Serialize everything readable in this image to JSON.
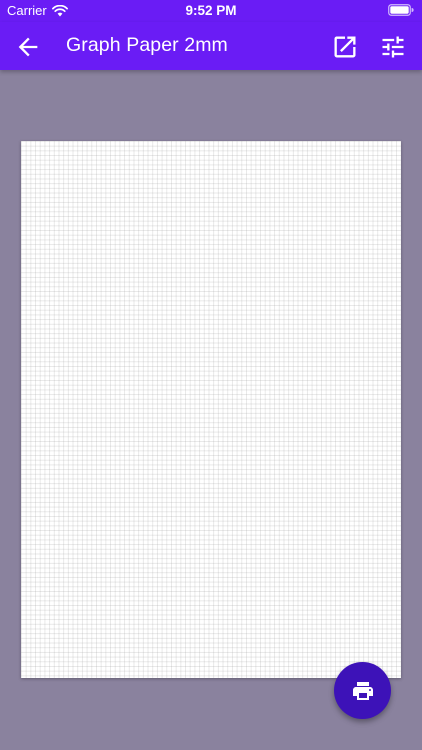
{
  "status_bar": {
    "carrier": "Carrier",
    "time": "9:52 PM"
  },
  "app_bar": {
    "title": "Graph Paper 2mm"
  },
  "icons": {
    "back": "arrow-left-icon",
    "open": "open-in-new-icon",
    "settings": "tune-sliders-icon",
    "print": "printer-icon",
    "wifi": "wifi-icon",
    "battery": "battery-icon"
  },
  "colors": {
    "primary": "#6a1cf5",
    "fab": "#3d12b8",
    "background": "#8a829e",
    "paper": "#ffffff"
  }
}
